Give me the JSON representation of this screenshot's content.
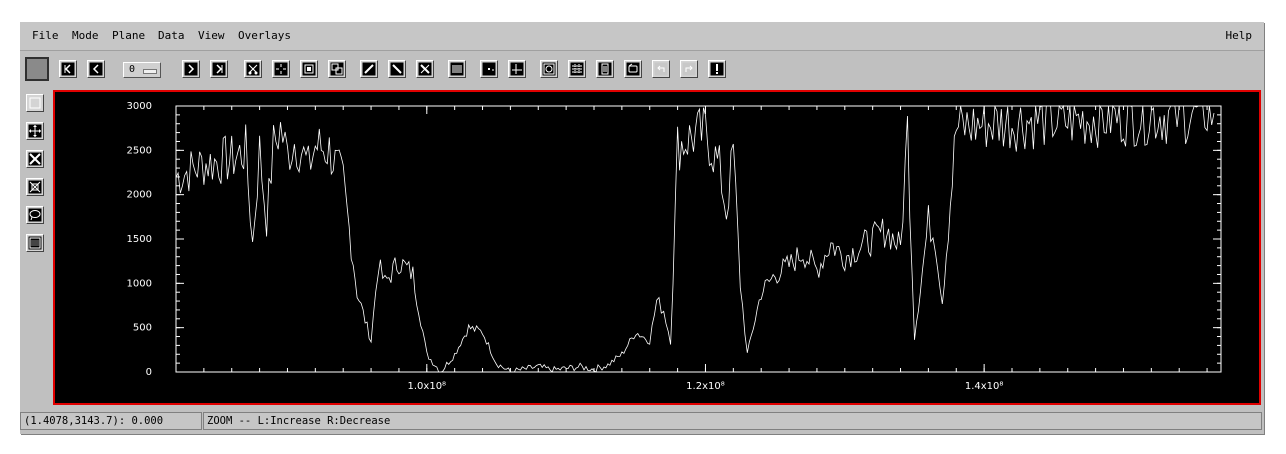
{
  "menu": {
    "file": "File",
    "mode": "Mode",
    "plane": "Plane",
    "data": "Data",
    "view": "View",
    "overlays": "Overlays",
    "help": "Help"
  },
  "toolbar": {
    "plane_value": "0",
    "icons": [
      "first-plane-icon",
      "prev-plane-icon",
      "next-plane-icon",
      "last-plane-icon",
      "cut-icon",
      "crosshair-icon",
      "frame-icon",
      "copy-region-icon",
      "pencil-icon",
      "line-icon",
      "cross-tool-icon",
      "histogram-icon",
      "point-icon",
      "axes-icon",
      "circle-frame-icon",
      "grid-icon",
      "list-icon",
      "loop-icon",
      "undo-icon",
      "redo-icon",
      "alert-icon"
    ]
  },
  "left_tools": [
    "select-box-icon",
    "pan-icon",
    "zoom-in-icon",
    "zoom-out-icon",
    "lasso-icon",
    "pattern-icon"
  ],
  "status": {
    "coords": "(1.4078,3143.7): 0.000",
    "message": "ZOOM -- L:Increase R:Decrease"
  },
  "colors": {
    "plot_background": "#000000",
    "plot_border": "#e00000",
    "trace": "#ffffff"
  },
  "chart_data": {
    "type": "line",
    "title": "",
    "xlabel": "",
    "ylabel": "",
    "xlim": [
      0.82,
      1.57
    ],
    "ylim": [
      0,
      3000
    ],
    "yticks": [
      0,
      500,
      1000,
      1500,
      2000,
      2500,
      3000
    ],
    "ytick_labels": [
      "0",
      "500",
      "1000",
      "1500",
      "2000",
      "2500",
      "3000"
    ],
    "xtick_labels": [
      {
        "value": 1.0,
        "label": "1.0x10⁸"
      },
      {
        "value": 1.2,
        "label": "1.2x10⁸"
      },
      {
        "value": 1.4,
        "label": "1.4x10⁸"
      }
    ],
    "grid": false,
    "series": [
      {
        "x": [
          0.82,
          0.84,
          0.86,
          0.87,
          0.875,
          0.88,
          0.885,
          0.89,
          0.895,
          0.9,
          0.905,
          0.91,
          0.915,
          0.92,
          0.93,
          0.94,
          0.95,
          0.96,
          0.965,
          0.97,
          0.98,
          0.99,
          1.0,
          1.01,
          1.02,
          1.03,
          1.04,
          1.05,
          1.06,
          1.07,
          1.08,
          1.09,
          1.1,
          1.11,
          1.12,
          1.13,
          1.14,
          1.15,
          1.16,
          1.165,
          1.17,
          1.175,
          1.18,
          1.19,
          1.2,
          1.21,
          1.215,
          1.22,
          1.225,
          1.23,
          1.24,
          1.25,
          1.26,
          1.27,
          1.28,
          1.29,
          1.3,
          1.31,
          1.32,
          1.33,
          1.34,
          1.345,
          1.35,
          1.36,
          1.365,
          1.37,
          1.38,
          1.4,
          1.42,
          1.44,
          1.46,
          1.48,
          1.5,
          1.52,
          1.54,
          1.56,
          1.565
        ],
        "y": [
          2200,
          2350,
          2400,
          2500,
          1450,
          2500,
          1700,
          2550,
          2750,
          2450,
          2600,
          2500,
          2300,
          2550,
          2500,
          2150,
          900,
          350,
          1200,
          1000,
          1250,
          1100,
          200,
          0,
          200,
          500,
          450,
          100,
          0,
          30,
          60,
          20,
          40,
          60,
          30,
          80,
          200,
          450,
          350,
          800,
          700,
          350,
          2550,
          2650,
          2700,
          2300,
          1800,
          2500,
          1000,
          200,
          900,
          1100,
          1200,
          1350,
          1150,
          1450,
          1300,
          1400,
          1500,
          1600,
          1400,
          2750,
          400,
          1700,
          1500,
          800,
          2750,
          2800,
          2820,
          2850,
          2830,
          2870,
          2880,
          2900,
          2900,
          2950,
          2920
        ]
      }
    ]
  }
}
